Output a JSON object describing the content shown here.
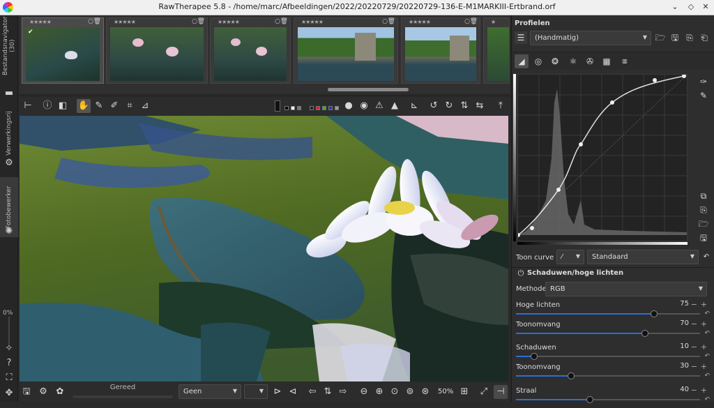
{
  "window": {
    "title": "RawTherapee 5.8 - /home/marc/Afbeeldingen/2022/20220729/20220729-136-E-M1MARKIII-Ertbrand.orf",
    "controls": [
      "minimize-icon",
      "maximize-icon",
      "close-icon"
    ]
  },
  "left_tabs": {
    "file_browser": "Bestandsnavigator (30)",
    "queue": "Verwerkingsrij",
    "editor": "Fotobewerker",
    "percent": "0%"
  },
  "filmstrip": {
    "thumbnails": [
      {
        "rating": "★★★★★",
        "selected": true,
        "scene": "lily-pads"
      },
      {
        "rating": "★★★★★",
        "selected": false,
        "scene": "pink-lilies"
      },
      {
        "rating": "★★★★★",
        "selected": false,
        "scene": "pink-lilies"
      },
      {
        "rating": "★★★★★",
        "selected": false,
        "scene": "ruin-pond"
      },
      {
        "rating": "★★★★★",
        "selected": false,
        "scene": "ruin-pond"
      },
      {
        "rating": "★",
        "selected": false,
        "scene": "partial"
      }
    ]
  },
  "bottombar": {
    "status": "Gereed",
    "mode_combo": "Geen",
    "zoom": "50%"
  },
  "right_panel": {
    "profiles_label": "Profielen",
    "profile_value": "(Handmatig)",
    "tone_curve_label": "Toon curve 2:",
    "tone_curve_mode": "Standaard",
    "section_title": "Schaduwen/hoge lichten",
    "method_label": "Methode:",
    "method_value": "RGB",
    "sliders": [
      {
        "label": "Hoge lichten",
        "value": "75",
        "fraction": 0.75
      },
      {
        "label": "Toonomvang",
        "value": "70",
        "fraction": 0.7
      },
      {
        "label": "Schaduwen",
        "value": "10",
        "fraction": 0.1
      },
      {
        "label": "Toonomvang",
        "value": "30",
        "fraction": 0.3
      },
      {
        "label": "Straal",
        "value": "40",
        "fraction": 0.4
      }
    ]
  },
  "colors": {
    "accent": "#2a6fd6",
    "panel": "#2e2e2e",
    "background": "#2a2a2a"
  }
}
